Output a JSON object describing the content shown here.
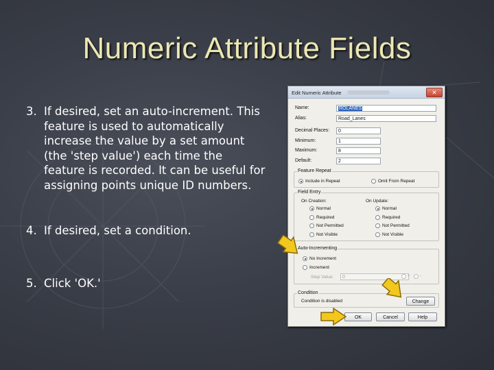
{
  "slide": {
    "title": "Numeric Attribute Fields",
    "steps": [
      {
        "num": "3.",
        "text": "If desired, set an auto-increment.  This feature is used to automatically increase the value by a set amount (the 'step value') each time the feature is recorded. It can be useful for assigning points unique ID numbers."
      },
      {
        "num": "4.",
        "text": "If desired, set a condition."
      },
      {
        "num": "5.",
        "text": "Click 'OK.'"
      }
    ]
  },
  "dialog": {
    "title": "Edit Numeric Attribute",
    "close_glyph": "✕",
    "fields": {
      "name_label": "Name:",
      "name_value": "ROLANES",
      "alias_label": "Alias:",
      "alias_value": "Road_Lanes",
      "decimal_label": "Decimal Places:",
      "decimal_value": "0",
      "min_label": "Minimum:",
      "min_value": "1",
      "max_label": "Maximum:",
      "max_value": "8",
      "default_label": "Default:",
      "default_value": "2"
    },
    "feature_repeat": {
      "title": "Feature Repeat",
      "include": "Include in Repeat",
      "omit": "Omit From Repeat"
    },
    "field_entry": {
      "title": "Field Entry",
      "on_creation": "On Creation:",
      "on_update": "On Update:",
      "options": [
        "Normal",
        "Required",
        "Not Permitted",
        "Not Visible"
      ]
    },
    "auto_increment": {
      "title": "Auto-Incrementing",
      "no_increment": "No Increment",
      "increment": "Increment",
      "step_label": "Step Value:",
      "step_value": "0",
      "plus": "+",
      "minus": "-"
    },
    "condition": {
      "title": "Condition",
      "status": "Condition is disabled",
      "change_label": "Change"
    },
    "buttons": {
      "ok": "OK",
      "cancel": "Cancel",
      "help": "Help"
    }
  },
  "colors": {
    "title_text": "#ece7b4",
    "arrow_fill": "#f2c81e",
    "arrow_stroke": "#8a6a08"
  }
}
